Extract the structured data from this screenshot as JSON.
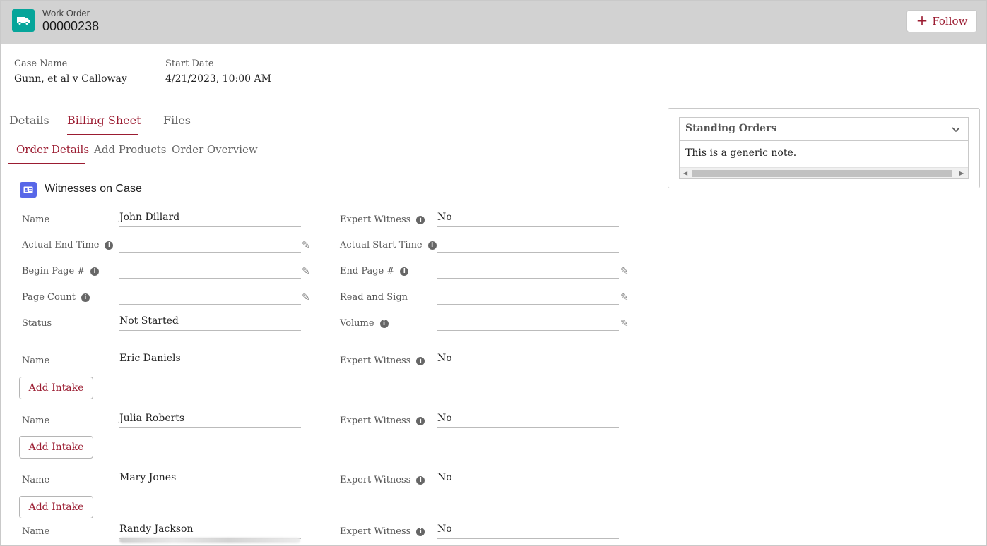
{
  "header": {
    "object_type": "Work Order",
    "record_number": "00000238",
    "follow_label": "Follow",
    "icon": "truck-icon"
  },
  "highlights": {
    "case_name_label": "Case Name",
    "case_name_value": "Gunn, et al v Calloway",
    "start_date_label": "Start Date",
    "start_date_value": "4/21/2023, 10:00 AM"
  },
  "tabs": [
    {
      "label": "Details",
      "active": false
    },
    {
      "label": "Billing Sheet",
      "active": true
    },
    {
      "label": "Files",
      "active": false
    }
  ],
  "subtabs": [
    {
      "label": "Order Details",
      "active": true
    },
    {
      "label": "Add Products",
      "active": false
    },
    {
      "label": "Order Overview",
      "active": false
    }
  ],
  "section": {
    "title": "Witnesses on Case",
    "icon": "contact-card-icon"
  },
  "witness1": {
    "name_label": "Name",
    "name_value": "John Dillard",
    "expert_label": "Expert Witness",
    "expert_value": "No",
    "actual_end_label": "Actual End Time",
    "actual_end_value": "",
    "actual_start_label": "Actual Start Time",
    "actual_start_value": "",
    "begin_page_label": "Begin Page #",
    "begin_page_value": "",
    "end_page_label": "End Page #",
    "end_page_value": "",
    "page_count_label": "Page Count",
    "page_count_value": "",
    "read_sign_label": "Read and Sign",
    "read_sign_value": "",
    "status_label": "Status",
    "status_value": "Not Started",
    "volume_label": "Volume",
    "volume_value": ""
  },
  "witnesses": [
    {
      "name_label": "Name",
      "name": "Eric Daniels",
      "expert_label": "Expert Witness",
      "expert": "No",
      "button": "Add Intake"
    },
    {
      "name_label": "Name",
      "name": "Julia Roberts",
      "expert_label": "Expert Witness",
      "expert": "No",
      "button": "Add Intake"
    },
    {
      "name_label": "Name",
      "name": "Mary Jones",
      "expert_label": "Expert Witness",
      "expert": "No",
      "button": "Add Intake"
    },
    {
      "name_label": "Name",
      "name": "Randy Jackson",
      "expert_label": "Expert Witness",
      "expert": "No"
    }
  ],
  "standing_orders": {
    "title": "Standing Orders",
    "note": "This is a generic note."
  },
  "colors": {
    "accent": "#9b1c31",
    "header_bg": "#d2d2d2",
    "work_order_icon": "#06a59a",
    "section_icon": "#5867e8"
  }
}
